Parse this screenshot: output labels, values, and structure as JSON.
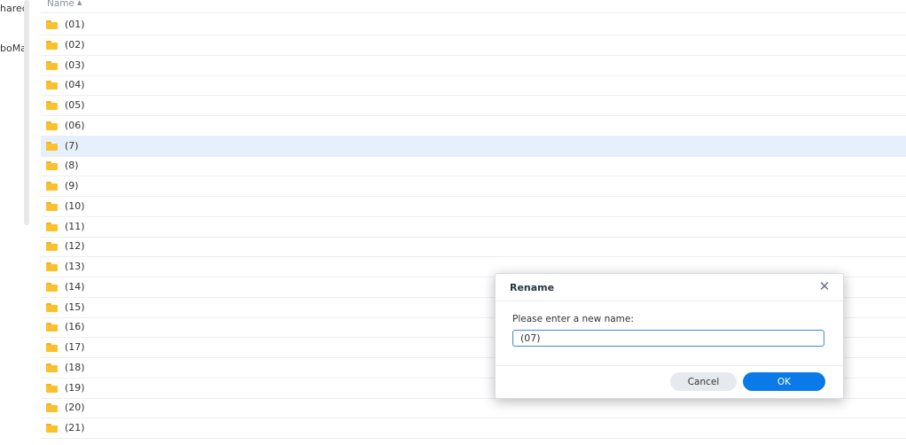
{
  "sidebar": {
    "items": [
      {
        "label": "hared"
      },
      {
        "label": "boMa"
      }
    ]
  },
  "file_list": {
    "column_name": "Name",
    "sort_indicator": "▲",
    "folder_icon": "folder-icon",
    "folder_color": "#fbc12d",
    "selected_index": 6,
    "rows": [
      "(01)",
      "(02)",
      "(03)",
      "(04)",
      "(05)",
      "(06)",
      "(7)",
      "(8)",
      "(9)",
      "(10)",
      "(11)",
      "(12)",
      "(13)",
      "(14)",
      "(15)",
      "(16)",
      "(17)",
      "(18)",
      "(19)",
      "(20)",
      "(21)"
    ]
  },
  "rename_dialog": {
    "title": "Rename",
    "close_glyph": "✕",
    "prompt": "Please enter a new name:",
    "input_value": "(07)",
    "cancel_label": "Cancel",
    "ok_label": "OK",
    "ok_color": "#0a7ae8"
  }
}
